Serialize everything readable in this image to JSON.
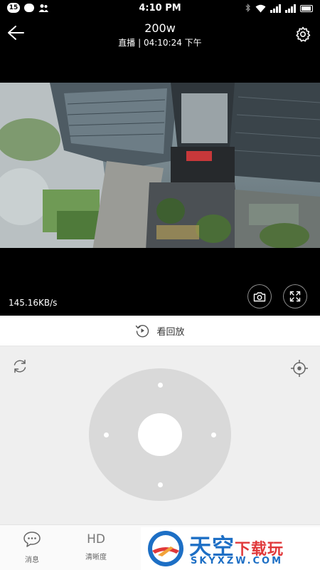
{
  "status_bar": {
    "notification_count": "15",
    "time": "4:10 PM",
    "icons": [
      "message-icon",
      "person-icon",
      "bluetooth-icon",
      "wifi-icon",
      "signal-icon",
      "battery-icon"
    ]
  },
  "header": {
    "title": "200w",
    "subtitle": "直播 | 04:10:24 下午",
    "back_icon": "back-arrow-icon",
    "settings_icon": "gear-icon"
  },
  "video": {
    "bitrate": "145.16KB/s",
    "snapshot_icon": "camera-icon",
    "fullscreen_icon": "fullscreen-icon"
  },
  "playback": {
    "label": "看回放",
    "icon": "replay-icon"
  },
  "controls": {
    "rotate_icon": "rotate-icon",
    "target_icon": "crosshair-icon"
  },
  "bottom_tabs": [
    {
      "label": "消息",
      "icon": "chat-icon"
    },
    {
      "label": "清晰度",
      "icon_text": "HD"
    }
  ],
  "watermark": {
    "brand_main": "天空",
    "brand_accent": "下载玩",
    "url": "SKYXZW.COM"
  },
  "colors": {
    "background_dark": "#000000",
    "control_bg": "#efefef",
    "dpad": "#d9d9d9",
    "watermark_blue": "#1d6fc5",
    "watermark_red": "#e0383a"
  }
}
